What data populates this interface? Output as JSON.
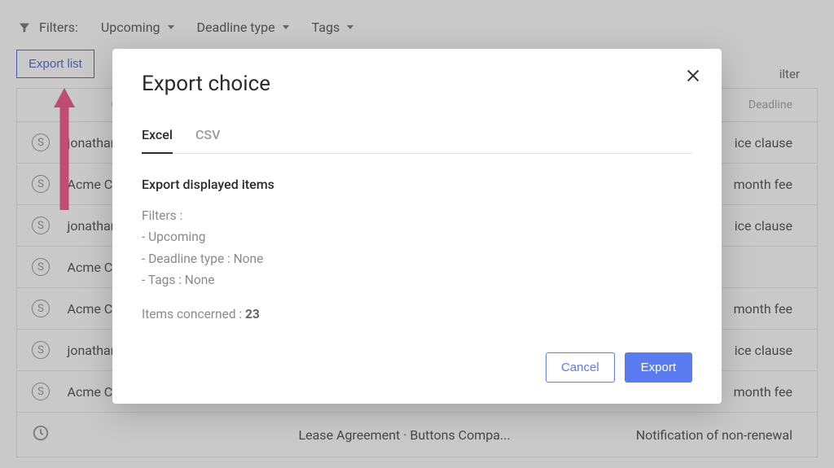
{
  "filters": {
    "label": "Filters:",
    "upcoming": "Upcoming",
    "deadline_type": "Deadline type",
    "tags": "Tags"
  },
  "toolbar": {
    "export_list": "Export list",
    "filter_link": "ilter"
  },
  "table": {
    "headers": {
      "party": "Other party",
      "deadline": "Deadline"
    },
    "rows": [
      {
        "icon": "money",
        "party": "jonathan@m",
        "deadline": "ice clause"
      },
      {
        "icon": "money",
        "party": "Acme Co",
        "deadline": "month fee"
      },
      {
        "icon": "money",
        "party": "jonathan@m",
        "deadline": "ice clause"
      },
      {
        "icon": "money",
        "party": "Acme Co",
        "deadline": ""
      },
      {
        "icon": "money",
        "party": "Acme Co",
        "deadline": "month fee"
      },
      {
        "icon": "money",
        "party": "jonathan@m",
        "deadline": "ice clause"
      },
      {
        "icon": "money",
        "party": "Acme Co",
        "deadline": "month fee"
      },
      {
        "icon": "clock",
        "party": "",
        "desc": "Lease Agreement · Buttons Compa...",
        "deadline": "Notification of non-renewal"
      }
    ]
  },
  "modal": {
    "title": "Export choice",
    "tabs": {
      "excel": "Excel",
      "csv": "CSV"
    },
    "subtitle": "Export displayed items",
    "filters_label": "Filters :",
    "filter_lines": [
      "- Upcoming",
      "- Deadline type : None",
      "- Tags : None"
    ],
    "items_concerned_label": "Items concerned : ",
    "items_concerned_count": "23",
    "cancel": "Cancel",
    "export": "Export"
  },
  "annotation": {
    "arrow_color": "#f04178"
  }
}
